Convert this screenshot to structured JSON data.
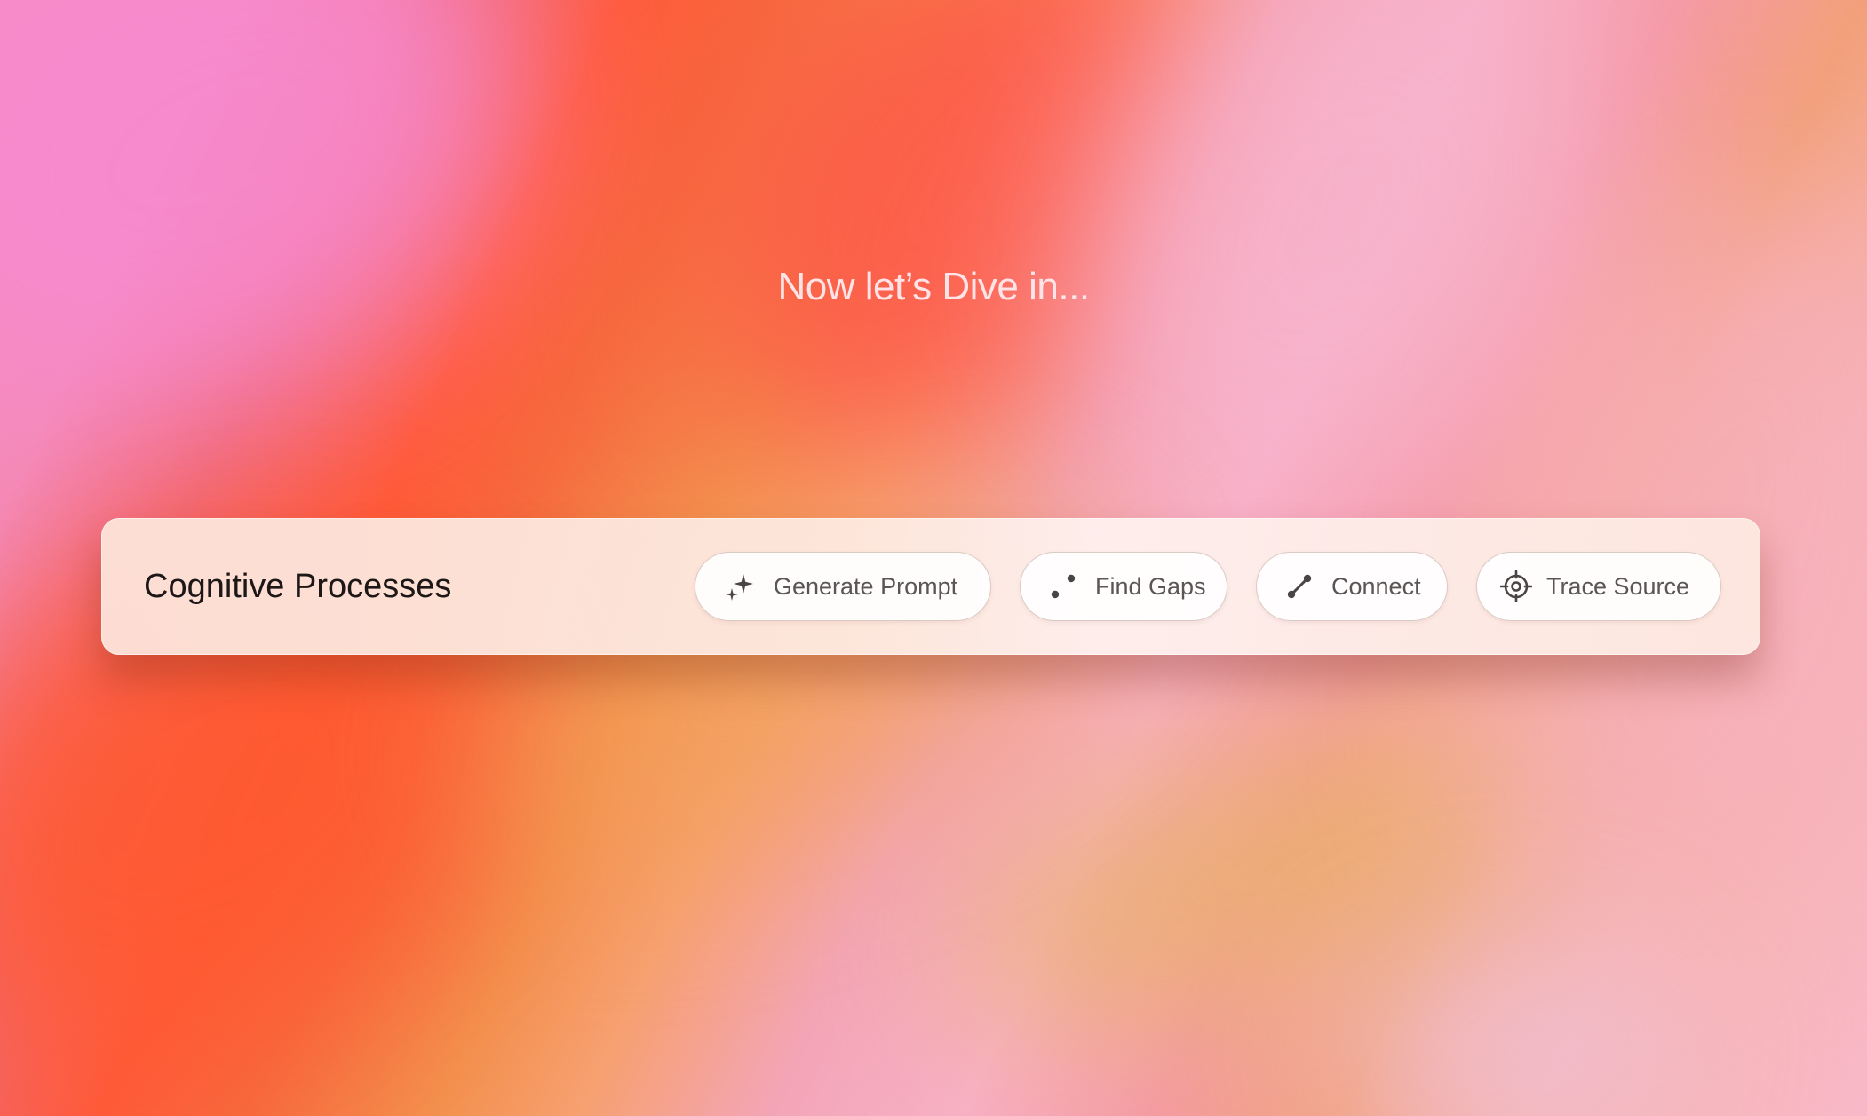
{
  "headline": "Now let’s Dive in...",
  "toolbar": {
    "title": "Cognitive Processes",
    "actions": [
      {
        "label": "Generate Prompt",
        "icon": "sparkles-icon"
      },
      {
        "label": "Find Gaps",
        "icon": "dots-icon"
      },
      {
        "label": "Connect",
        "icon": "connect-line-icon"
      },
      {
        "label": "Trace Source",
        "icon": "crosshair-icon"
      }
    ]
  },
  "colors": {
    "title_text": "#1d1717",
    "pill_text": "#5b5555",
    "icon": "#4a4444",
    "headline_text": "#ffe3e6"
  }
}
